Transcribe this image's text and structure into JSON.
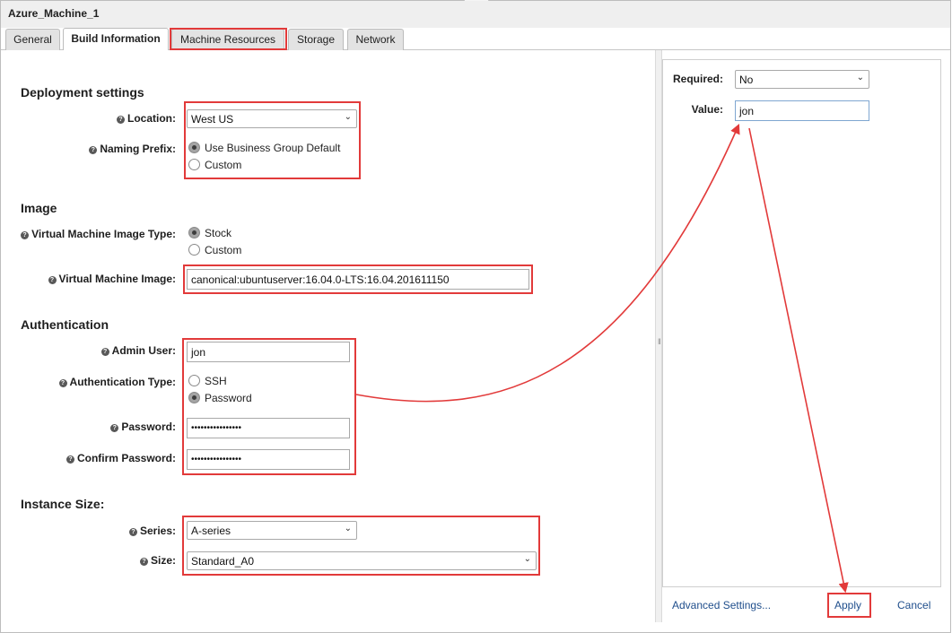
{
  "window": {
    "title": "Azure_Machine_1"
  },
  "tabs": [
    {
      "label": "General"
    },
    {
      "label": "Build Information"
    },
    {
      "label": "Machine Resources"
    },
    {
      "label": "Storage"
    },
    {
      "label": "Network"
    }
  ],
  "deployment": {
    "heading": "Deployment settings",
    "location_label": "Location:",
    "location_value": "West US",
    "naming_prefix_label": "Naming Prefix:",
    "naming_options": [
      "Use Business Group Default",
      "Custom"
    ],
    "naming_selected": "Use Business Group Default"
  },
  "image": {
    "heading": "Image",
    "vm_image_type_label": "Virtual Machine Image Type:",
    "vm_image_type_options": [
      "Stock",
      "Custom"
    ],
    "vm_image_type_selected": "Stock",
    "vm_image_label": "Virtual Machine Image:",
    "vm_image_value": "canonical:ubuntuserver:16.04.0-LTS:16.04.201611150"
  },
  "auth": {
    "heading": "Authentication",
    "admin_user_label": "Admin User:",
    "admin_user_value": "jon",
    "auth_type_label": "Authentication Type:",
    "auth_type_options": [
      "SSH",
      "Password"
    ],
    "auth_type_selected": "Password",
    "password_label": "Password:",
    "password_value": "••••••••••••••••",
    "confirm_password_label": "Confirm Password:",
    "confirm_password_value": "••••••••••••••••"
  },
  "instance": {
    "heading": "Instance Size:",
    "series_label": "Series:",
    "series_value": "A-series",
    "size_label": "Size:",
    "size_value": "Standard_A0"
  },
  "right_panel": {
    "required_label": "Required:",
    "required_value": "No",
    "value_label": "Value:",
    "value_value": "jon",
    "advanced_link": "Advanced Settings...",
    "apply_button": "Apply",
    "cancel_button": "Cancel"
  },
  "colors": {
    "highlight": "#e23a3a",
    "link": "#1f4e8c",
    "tab_bg": "#e3e3e3",
    "titlebar_bg": "#efefef"
  },
  "icons": {
    "help": "help-icon",
    "dropdown": "chevron-down-icon"
  }
}
